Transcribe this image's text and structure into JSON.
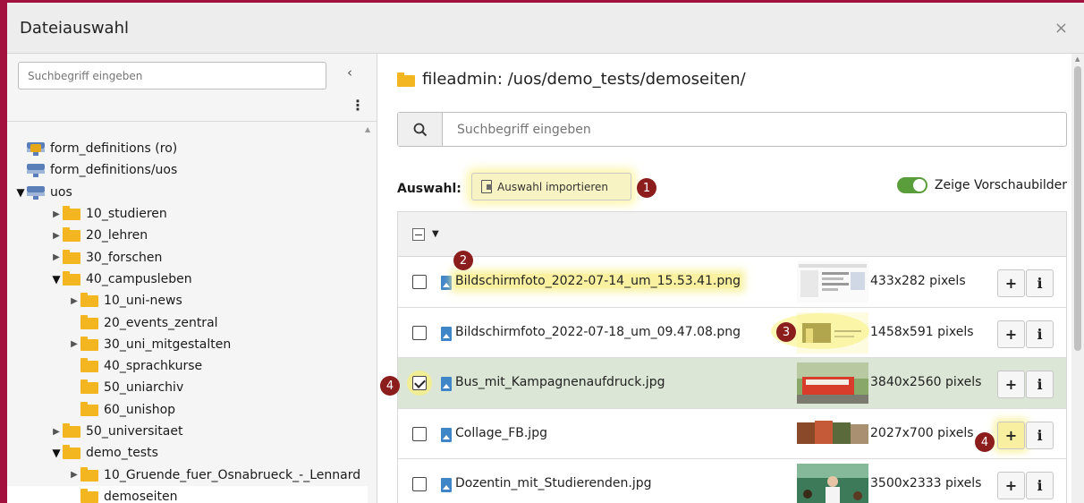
{
  "dialog": {
    "title": "Dateiauswahl",
    "close": "×"
  },
  "sidebar": {
    "search_placeholder": "Suchbegriff eingeben",
    "collapse": "‹",
    "menu": "⋮",
    "tree": [
      {
        "label": "form_definitions (ro)",
        "level": 0,
        "type": "storage-locked",
        "toggle": "none"
      },
      {
        "label": "form_definitions/uos",
        "level": 0,
        "type": "storage",
        "toggle": "none"
      },
      {
        "label": "uos",
        "level": 0,
        "type": "storage",
        "toggle": "open"
      },
      {
        "label": "10_studieren",
        "level": 1,
        "type": "folder",
        "toggle": "closed"
      },
      {
        "label": "20_lehren",
        "level": 1,
        "type": "folder",
        "toggle": "closed"
      },
      {
        "label": "30_forschen",
        "level": 1,
        "type": "folder",
        "toggle": "closed"
      },
      {
        "label": "40_campusleben",
        "level": 1,
        "type": "folder",
        "toggle": "open"
      },
      {
        "label": "10_uni-news",
        "level": 2,
        "type": "folder",
        "toggle": "closed"
      },
      {
        "label": "20_events_zentral",
        "level": 2,
        "type": "folder",
        "toggle": "none"
      },
      {
        "label": "30_uni_mitgestalten",
        "level": 2,
        "type": "folder",
        "toggle": "closed"
      },
      {
        "label": "40_sprachkurse",
        "level": 2,
        "type": "folder",
        "toggle": "none"
      },
      {
        "label": "50_uniarchiv",
        "level": 2,
        "type": "folder",
        "toggle": "none"
      },
      {
        "label": "60_unishop",
        "level": 2,
        "type": "folder",
        "toggle": "none"
      },
      {
        "label": "50_universitaet",
        "level": 1,
        "type": "folder",
        "toggle": "closed"
      },
      {
        "label": "demo_tests",
        "level": 1,
        "type": "folder",
        "toggle": "open"
      },
      {
        "label": "10_Gruende_fuer_Osnabrueck_-_Lennard",
        "level": 2,
        "type": "folder",
        "toggle": "closed"
      },
      {
        "label": "demoseiten",
        "level": 2,
        "type": "folder",
        "toggle": "none",
        "selected": true
      }
    ]
  },
  "main": {
    "path": "fileadmin: /uos/demo_tests/demoseiten/",
    "search_placeholder": "Suchbegriff eingeben",
    "selection_label": "Auswahl:",
    "import_button": "Auswahl importieren",
    "preview_toggle_label": "Zeige Vorschaubilder",
    "preview_toggle_on": true,
    "files": [
      {
        "name": "Bildschirmfoto_2022-07-14_um_15.53.41.png",
        "dims": "433x282 pixels",
        "checked": false,
        "thumb": "screenshot-light"
      },
      {
        "name": "Bildschirmfoto_2022-07-18_um_09.47.08.png",
        "dims": "1458x591 pixels",
        "checked": false,
        "thumb": "screenshot-dark"
      },
      {
        "name": "Bus_mit_Kampagnenaufdruck.jpg",
        "dims": "3840x2560 pixels",
        "checked": true,
        "thumb": "bus"
      },
      {
        "name": "Collage_FB.jpg",
        "dims": "2027x700 pixels",
        "checked": false,
        "thumb": "collage"
      },
      {
        "name": "Dozentin_mit_Studierenden.jpg",
        "dims": "3500x2333 pixels",
        "checked": false,
        "thumb": "classroom"
      }
    ],
    "add_label": "+",
    "info_label": "i"
  },
  "annotations": [
    "1",
    "2",
    "3",
    "4",
    "4"
  ],
  "colors": {
    "accent_border": "#a3123f",
    "folder": "#f3b620",
    "toggle_on": "#5a9e3c",
    "badge": "#8b1d1d",
    "highlight": "#f8f0a0"
  }
}
